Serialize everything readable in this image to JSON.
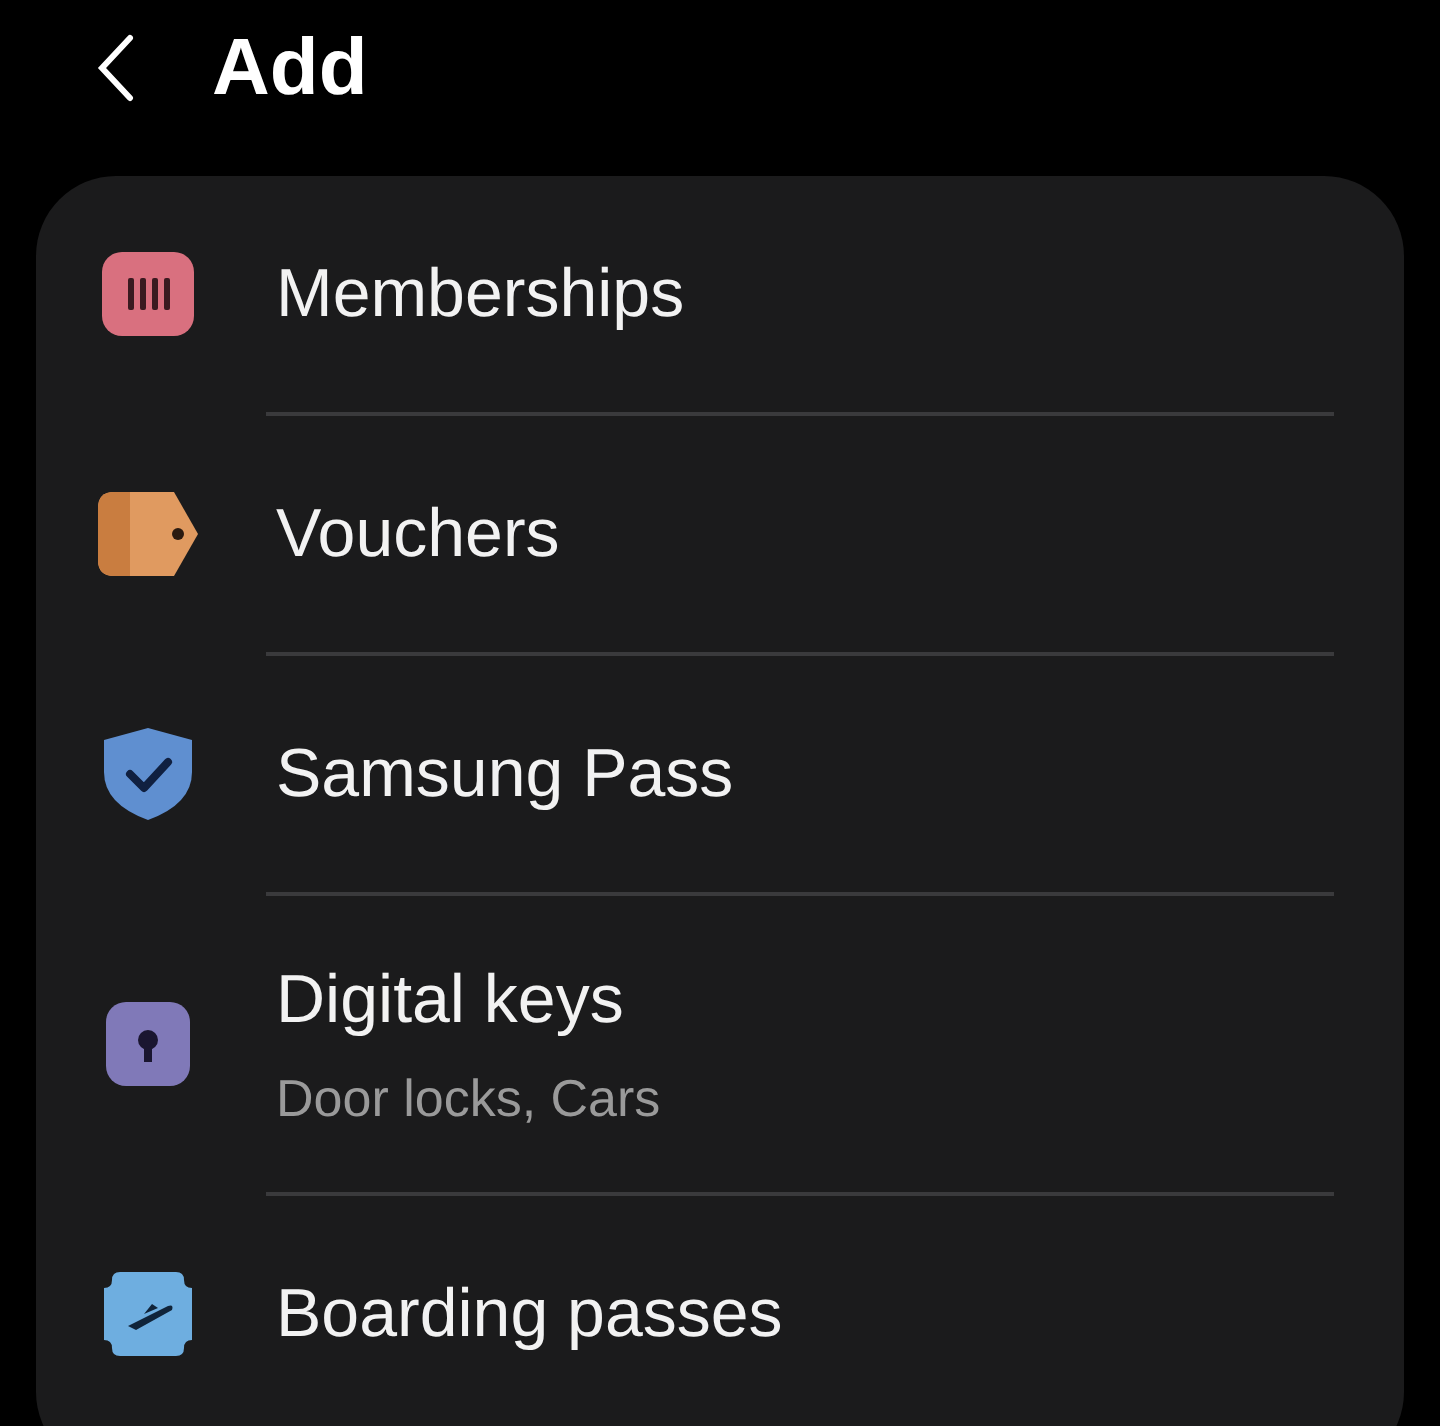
{
  "header": {
    "title": "Add"
  },
  "items": [
    {
      "kind": "membership",
      "label": "Memberships"
    },
    {
      "kind": "voucher",
      "label": "Vouchers"
    },
    {
      "kind": "pass",
      "label": "Samsung Pass"
    },
    {
      "kind": "key",
      "label": "Digital keys",
      "subtitle": "Door locks, Cars"
    },
    {
      "kind": "boarding",
      "label": "Boarding passes"
    }
  ]
}
